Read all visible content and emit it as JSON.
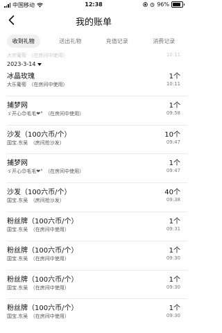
{
  "status": {
    "carrier": "中国移动",
    "time": "12:38",
    "battery": "96%"
  },
  "header": {
    "title": "我的账单"
  },
  "tabs": [
    {
      "label": "收到礼物",
      "active": true
    },
    {
      "label": "送出礼物",
      "active": false
    },
    {
      "label": "充值记录",
      "active": false
    },
    {
      "label": "消费记录",
      "active": false
    }
  ],
  "faded_row": {
    "left": "大宗葡萄　（在房间中使用）",
    "right": "10:11"
  },
  "date_header": "2023-3-14",
  "rows": [
    {
      "name": "冰晶玫瑰",
      "sub": "大乐葡萄　（在房间中使用）",
      "count": "1个",
      "time": "10:11"
    },
    {
      "name": "捕梦网",
      "sub": "ゞ开心😊毛毛❤°　（在房间中使用）",
      "count": "1个",
      "time": "09:58"
    },
    {
      "name": "沙发（100六币/个）",
      "sub": "国宝.东吴　（房间抢沙发）",
      "count": "10个",
      "time": "09:47"
    },
    {
      "name": "捕梦网",
      "sub": "ゞ开心😊毛毛❤°　（在房间中使用）",
      "count": "1个",
      "time": "09:47"
    },
    {
      "name": "沙发（100六币/个）",
      "sub": "国宝.东吴　（房间抢沙发）",
      "count": "40个",
      "time": "09:38"
    },
    {
      "name": "粉丝牌（100六币/个）",
      "sub": "国宝.东吴　（在房间中使用）",
      "count": "1个",
      "time": "09:31"
    },
    {
      "name": "粉丝牌（100六币/个）",
      "sub": "国宝.东吴　（在房间中使用）",
      "count": "1个",
      "time": "09:30"
    },
    {
      "name": "粉丝牌（100六币/个）",
      "sub": "国宝.东吴　（在房间中使用）",
      "count": "1个",
      "time": "09:30"
    },
    {
      "name": "粉丝牌（100六币/个）",
      "sub": "国宝.东吴　（在房间中使用）",
      "count": "1个",
      "time": "09:30"
    }
  ],
  "icons": {
    "back": "chevron-left-icon",
    "signal": "signal-icon",
    "wifi": "wifi-icon",
    "battery": "battery-icon",
    "lock": "orientation-lock-icon",
    "alarm": "alarm-icon",
    "date_toggle": "triangle-down-icon"
  }
}
